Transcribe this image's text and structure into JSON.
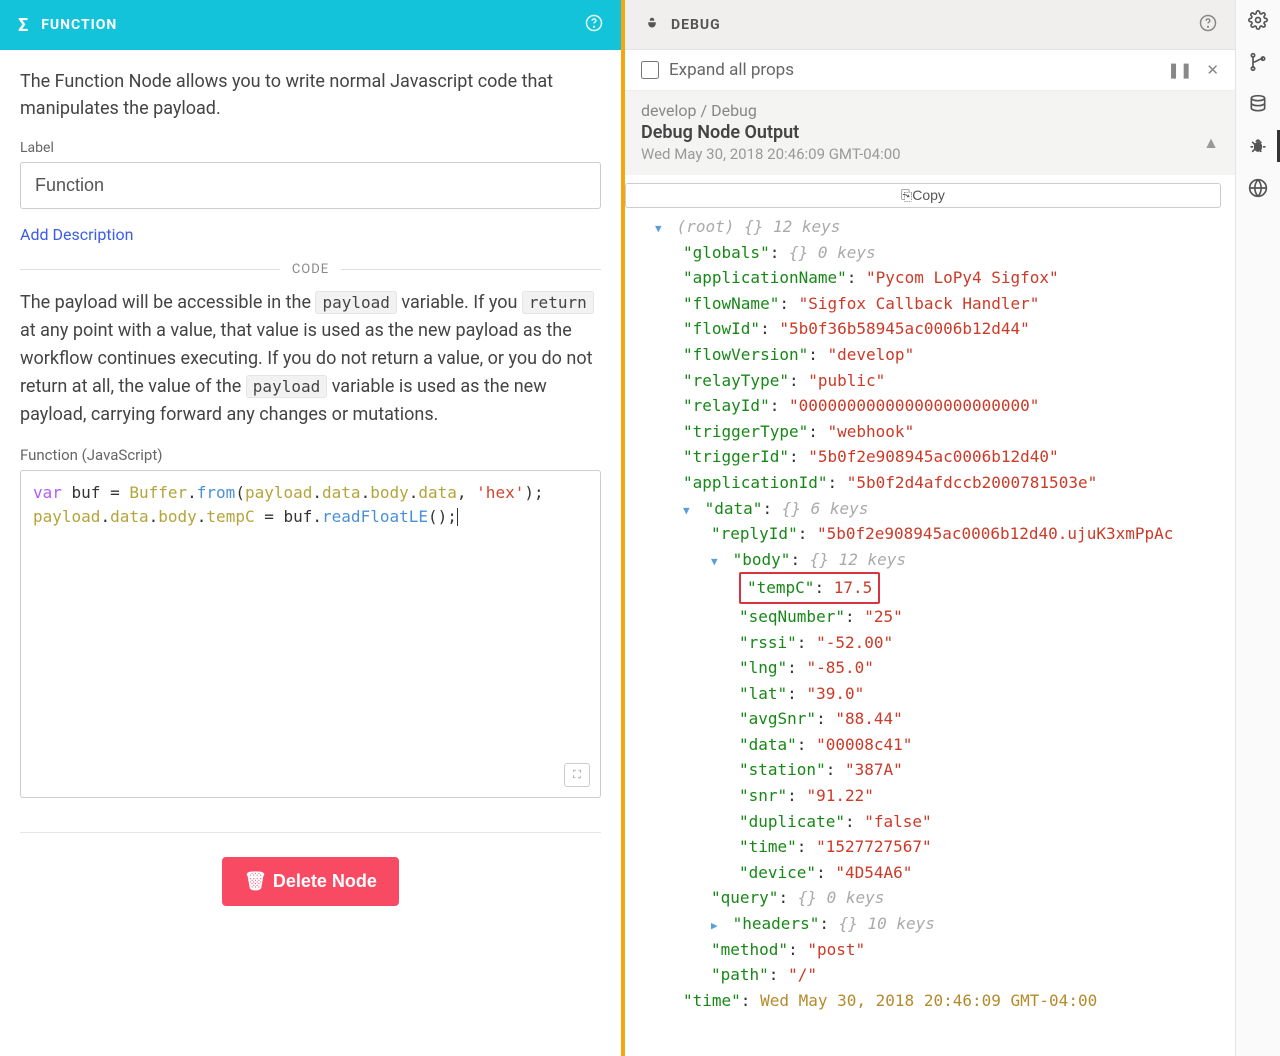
{
  "leftPanel": {
    "title": "FUNCTION",
    "intro": "The Function Node allows you to write normal Javascript code that manipulates the payload.",
    "labelField": {
      "label": "Label",
      "value": "Function"
    },
    "addDescription": "Add Description",
    "codeSeparator": "CODE",
    "descriptionParts": {
      "p1": "The payload will be accessible in the ",
      "code1": "payload",
      "p2": " variable. If you ",
      "code2": "return",
      "p3": " at any point with a value, that value is used as the new payload as the workflow continues executing. If you do not return a value, or you do not return at all, the value of the ",
      "code3": "payload",
      "p4": " variable is used as the new payload, carrying forward any changes or mutations."
    },
    "editorLabel": "Function (JavaScript)",
    "code": {
      "l1": {
        "kw": "var",
        "v1": " buf = ",
        "cls": "Buffer",
        "dot1": ".",
        "m1": "from",
        "op1": "(",
        "v2": "payload",
        "dot2": ".",
        "v3": "data",
        "dot3": ".",
        "v4": "body",
        "dot4": ".",
        "v5": "data",
        "op2": ", ",
        "str": "'hex'",
        "op3": ");"
      },
      "l2": {
        "v1": "payload",
        "dot1": ".",
        "v2": "data",
        "dot2": ".",
        "v3": "body",
        "dot3": ".",
        "v4": "tempC",
        "op1": " = buf.",
        "m1": "readFloatLE",
        "op2": "();"
      }
    },
    "deleteLabel": "Delete Node"
  },
  "debugPanel": {
    "title": "DEBUG",
    "expandAll": "Expand all props",
    "breadcrumb": "develop / Debug",
    "outputTitle": "Debug Node Output",
    "timestamp": "Wed May 30, 2018 20:46:09 GMT-04:00",
    "copy": "Copy",
    "tree": {
      "rootMeta": "(root)  {}  12 keys",
      "globals": {
        "key": "\"globals\"",
        "meta": "{}  0 keys"
      },
      "applicationName": "\"Pycom LoPy4 Sigfox\"",
      "flowName": "\"Sigfox Callback Handler\"",
      "flowId": "\"5b0f36b58945ac0006b12d44\"",
      "flowVersion": "\"develop\"",
      "relayType": "\"public\"",
      "relayId": "\"000000000000000000000000\"",
      "triggerType": "\"webhook\"",
      "triggerId": "\"5b0f2e908945ac0006b12d40\"",
      "applicationId": "\"5b0f2d4afdccb2000781503e\"",
      "data": {
        "meta": "{}  6 keys"
      },
      "replyId": "\"5b0f2e908945ac0006b12d40.ujuK3xmPpAc",
      "body": {
        "meta": "{}  12 keys"
      },
      "tempC": "17.5",
      "seqNumber": "\"25\"",
      "rssi": "\"-52.00\"",
      "lng": "\"-85.0\"",
      "lat": "\"39.0\"",
      "avgSnr": "\"88.44\"",
      "dataField": "\"00008c41\"",
      "station": "\"387A\"",
      "snr": "\"91.22\"",
      "duplicate": "\"false\"",
      "timeBody": "\"1527727567\"",
      "device": "\"4D54A6\"",
      "query": {
        "meta": "{}  0 keys"
      },
      "headers": {
        "meta": "{}  10 keys"
      },
      "method": "\"post\"",
      "path": "\"/\"",
      "timeOuter": "Wed May 30, 2018 20:46:09 GMT-04:00"
    }
  }
}
